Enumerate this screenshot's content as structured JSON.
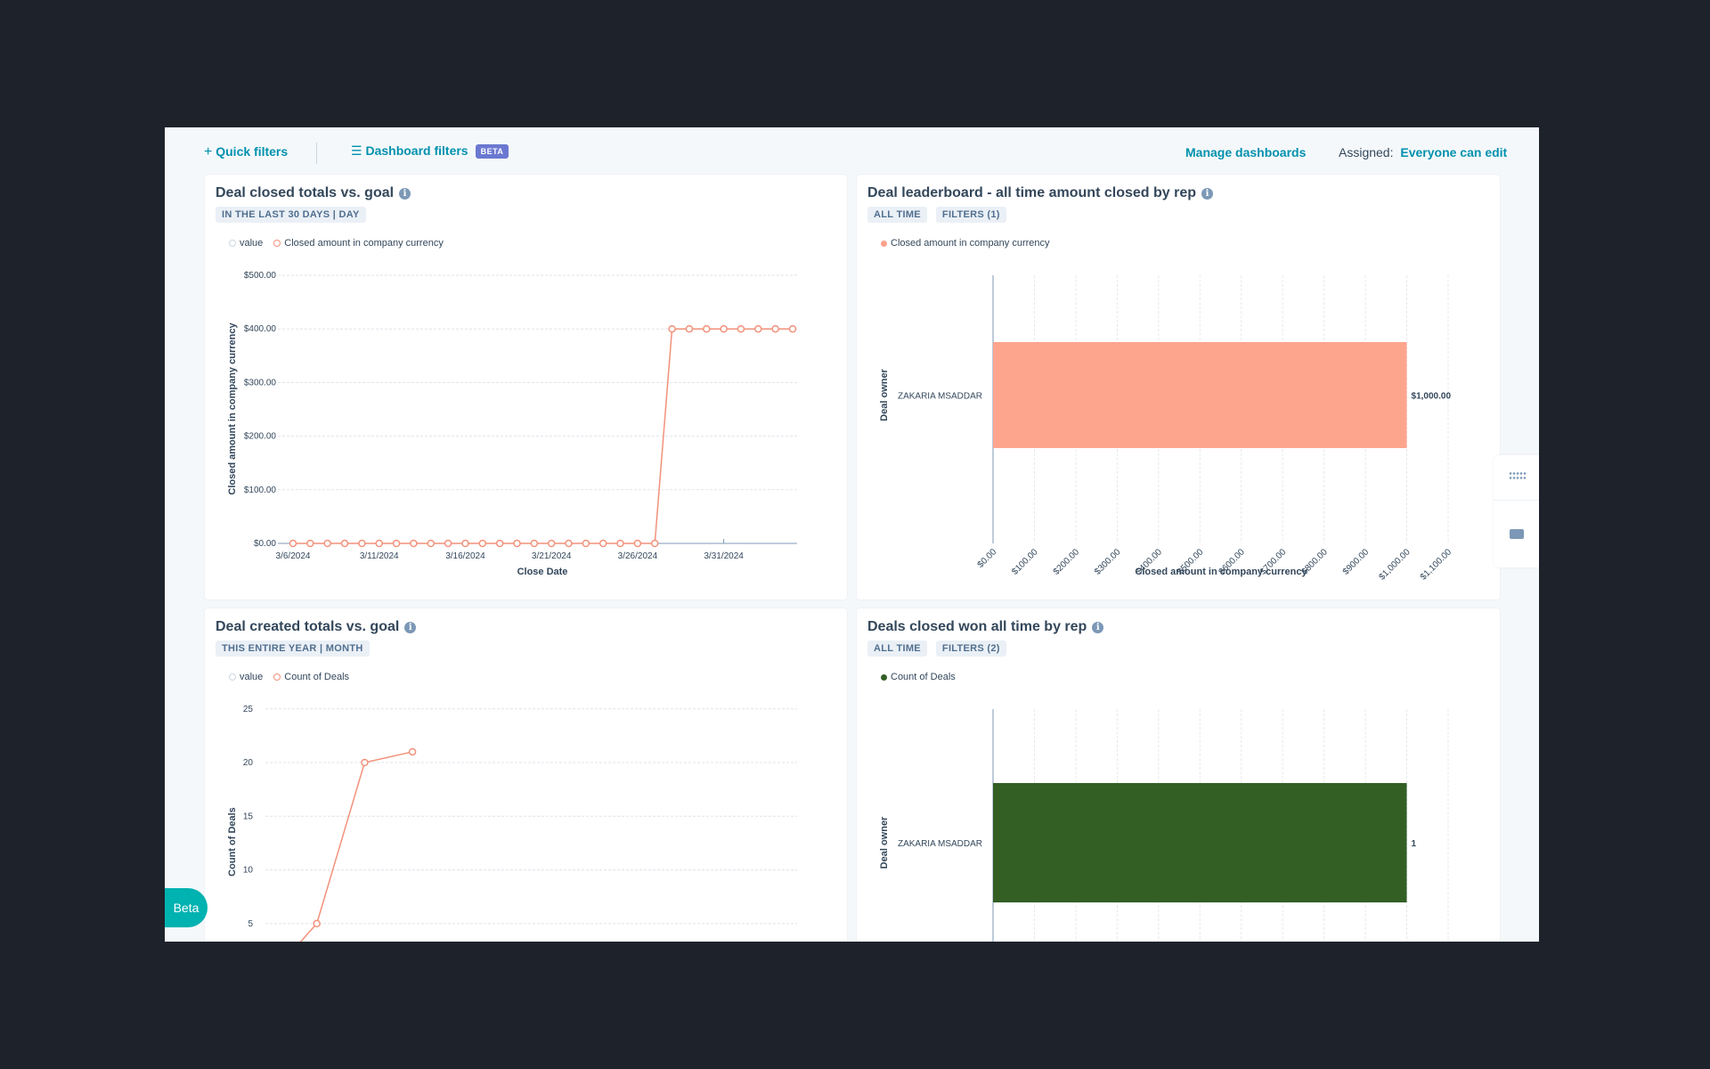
{
  "toolbar": {
    "quick_filters": "Quick filters",
    "dashboard_filters": "Dashboard filters",
    "beta_badge": "BETA",
    "manage_dashboards": "Manage dashboards",
    "assigned_label": "Assigned:",
    "assigned_value": "Everyone can edit"
  },
  "beta_button": "Beta",
  "icons": {
    "plus": "plus-icon",
    "filters": "sliders-icon",
    "info": "info-icon",
    "grid": "grid-icon",
    "chat": "chat-icon"
  },
  "colors": {
    "accent": "#0091ae",
    "salmon_line": "#f2917a",
    "salmon_bar": "#fea58e",
    "green_bar": "#335f24",
    "beta": "#6a78d1"
  },
  "cards": [
    {
      "title": "Deal closed totals vs. goal",
      "tags": [
        "IN THE LAST 30 DAYS | DAY"
      ],
      "legend": [
        "value",
        "Closed amount in company currency"
      ]
    },
    {
      "title": "Deal leaderboard - all time amount closed by rep",
      "tags": [
        "ALL TIME",
        "FILTERS (1)"
      ],
      "legend": [
        "Closed amount in company currency"
      ]
    },
    {
      "title": "Deal created totals vs. goal",
      "tags": [
        "THIS ENTIRE YEAR | MONTH"
      ],
      "legend": [
        "value",
        "Count of Deals"
      ]
    },
    {
      "title": "Deals closed won all time by rep",
      "tags": [
        "ALL TIME",
        "FILTERS (2)"
      ],
      "legend": [
        "Count of Deals"
      ]
    }
  ],
  "chart_data": [
    {
      "type": "line",
      "title": "Deal closed totals vs. goal",
      "xlabel": "Close Date",
      "ylabel": "Closed amount in company currency",
      "x": [
        "3/6/2024",
        "3/7/2024",
        "3/8/2024",
        "3/9/2024",
        "3/10/2024",
        "3/11/2024",
        "3/12/2024",
        "3/13/2024",
        "3/14/2024",
        "3/15/2024",
        "3/16/2024",
        "3/17/2024",
        "3/18/2024",
        "3/19/2024",
        "3/20/2024",
        "3/21/2024",
        "3/22/2024",
        "3/23/2024",
        "3/24/2024",
        "3/25/2024",
        "3/26/2024",
        "3/27/2024",
        "3/28/2024",
        "3/29/2024",
        "3/30/2024",
        "3/31/2024",
        "4/1/2024",
        "4/2/2024",
        "4/3/2024",
        "4/4/2024"
      ],
      "series": [
        {
          "name": "Closed amount in company currency",
          "values": [
            0,
            0,
            0,
            0,
            0,
            0,
            0,
            0,
            0,
            0,
            0,
            0,
            0,
            0,
            0,
            0,
            0,
            0,
            0,
            0,
            0,
            0,
            400,
            400,
            400,
            400,
            400,
            400,
            400,
            400
          ]
        }
      ],
      "x_tick_labels": [
        "3/6/2024",
        "3/11/2024",
        "3/16/2024",
        "3/21/2024",
        "3/26/2024",
        "3/31/2024"
      ],
      "y_tick_labels": [
        "$0.00",
        "$100.00",
        "$200.00",
        "$300.00",
        "$400.00",
        "$500.00"
      ],
      "ylim": [
        0,
        500
      ],
      "grid": true,
      "legend": "top-left"
    },
    {
      "type": "bar",
      "orientation": "horizontal",
      "title": "Deal leaderboard - all time amount closed by rep",
      "xlabel": "Closed amount in company currency",
      "ylabel": "Deal owner",
      "categories": [
        "ZAKARIA MSADDAR"
      ],
      "series": [
        {
          "name": "Closed amount in company currency",
          "values": [
            1000
          ]
        }
      ],
      "data_labels": [
        "$1,000.00"
      ],
      "x_tick_labels": [
        "$0.00",
        "$100.00",
        "$200.00",
        "$300.00",
        "$400.00",
        "$500.00",
        "$600.00",
        "$700.00",
        "$800.00",
        "$900.00",
        "$1,000.00",
        "$1,100.00"
      ],
      "xlim": [
        0,
        1100
      ],
      "grid": true,
      "legend": "top-left"
    },
    {
      "type": "line",
      "title": "Deal created totals vs. goal",
      "ylabel": "Count of Deals",
      "series": [
        {
          "name": "Count of Deals",
          "values": [
            0,
            5,
            20,
            21
          ]
        }
      ],
      "y_tick_labels": [
        "5",
        "10",
        "15",
        "20",
        "25"
      ],
      "ylim": [
        0,
        25
      ],
      "grid": true,
      "legend": "top-left"
    },
    {
      "type": "bar",
      "orientation": "horizontal",
      "title": "Deals closed won all time by rep",
      "ylabel": "Deal owner",
      "categories": [
        "ZAKARIA MSADDAR"
      ],
      "series": [
        {
          "name": "Count of Deals",
          "values": [
            1
          ]
        }
      ],
      "data_labels": [
        "1"
      ],
      "xlim": [
        0,
        1.1
      ],
      "grid": true,
      "legend": "top-left"
    }
  ]
}
